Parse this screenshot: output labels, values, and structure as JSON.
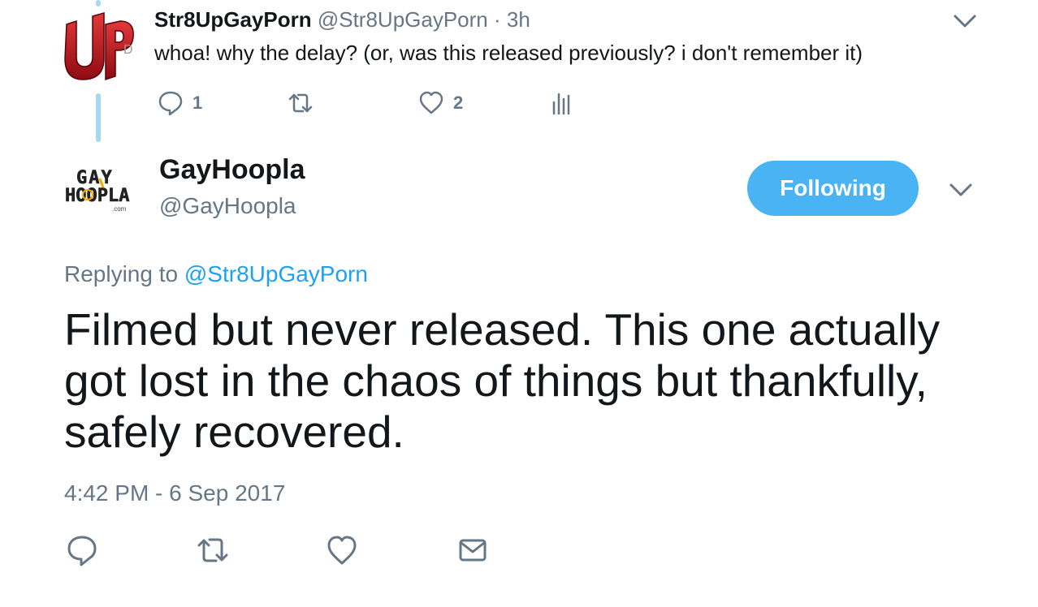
{
  "parent_tweet": {
    "display_name": "Str8UpGayPorn",
    "handle": "@Str8UpGayPorn",
    "time": "· 3h",
    "text": "whoa! why the delay? (or, was this released previously? i don't remember it)",
    "avatar_text": "UP",
    "actions": {
      "reply_count": "1",
      "retweet_count": "",
      "like_count": "2"
    }
  },
  "main_tweet": {
    "display_name": "GayHoopla",
    "handle": "@GayHoopla",
    "avatar_text": [
      "GAY",
      "HOOPLA",
      ".com"
    ],
    "follow_label": "Following",
    "replying_prefix": "Replying to",
    "replying_to": "@Str8UpGayPorn",
    "text": "Filmed but never released. This one actually got lost in the chaos of things but thankfully, safely recovered.",
    "timestamp": "4:42 PM - 6 Sep 2017"
  },
  "icons": {
    "reply": "reply-icon",
    "retweet": "retweet-icon",
    "like": "heart-icon",
    "analytics": "analytics-icon",
    "dm": "envelope-icon",
    "more": "chevron-down-icon"
  },
  "colors": {
    "accent": "#1da1f2",
    "follow_button": "#4ab3f4",
    "thread_line": "#a7d7f4",
    "muted": "#657786",
    "text": "#14171a",
    "avatar_red": "#c8102e"
  }
}
